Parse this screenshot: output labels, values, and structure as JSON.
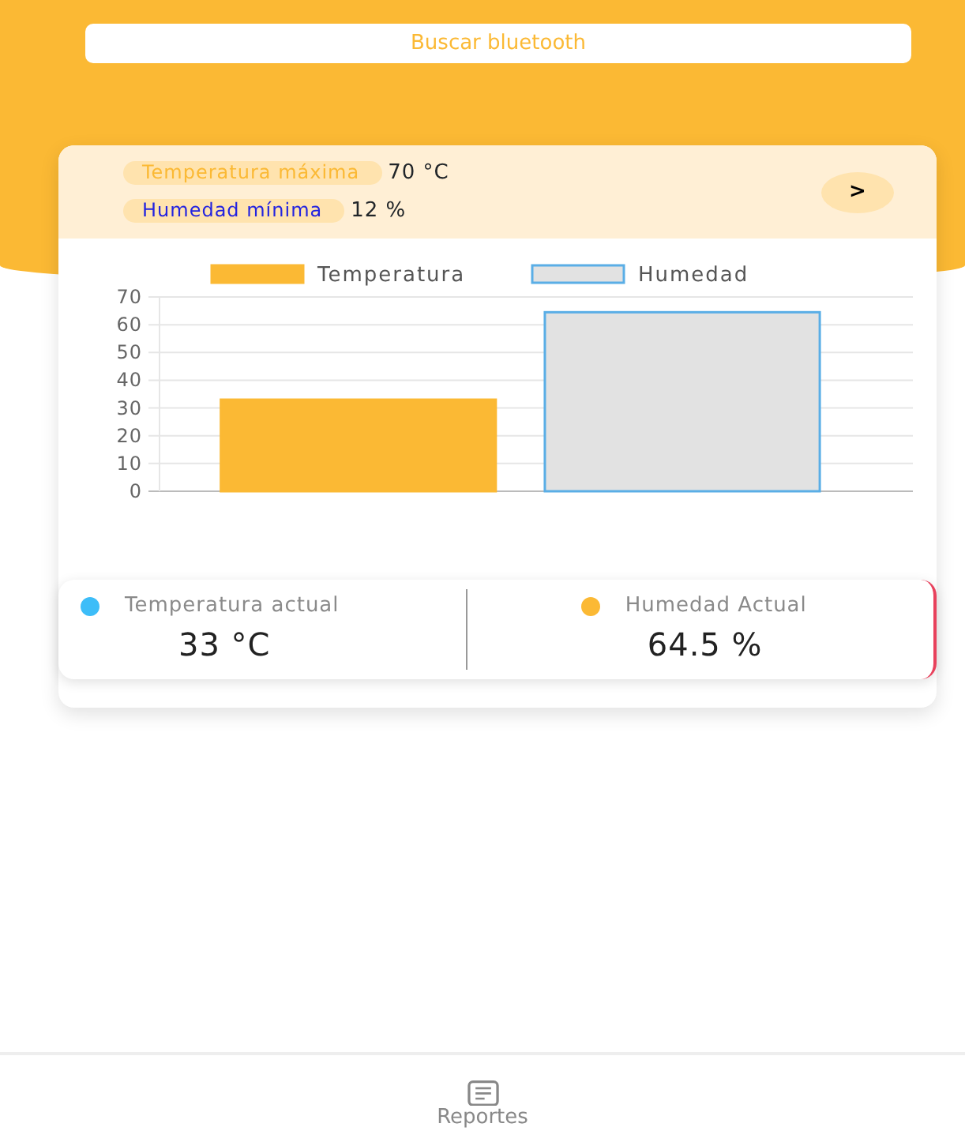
{
  "search_button": {
    "label": "Buscar bluetooth"
  },
  "limits": [
    {
      "label": "Temperatura máxima",
      "value": "70 °C",
      "color": "#fbb934"
    },
    {
      "label": "Humedad mínima",
      "value": "12 %",
      "color": "#2323e0"
    }
  ],
  "next_button": {
    "label": ">"
  },
  "chart_data": {
    "type": "bar",
    "grid": true,
    "legend": true,
    "ylim": [
      0,
      70
    ],
    "yticks": [
      0,
      10,
      20,
      30,
      40,
      50,
      60,
      70
    ],
    "series": [
      {
        "name": "Temperatura",
        "color": "#fbb934",
        "values": [
          33
        ]
      },
      {
        "name": "Humedad",
        "color": "#e2e2e2",
        "values": [
          64.5
        ]
      }
    ]
  },
  "readings": [
    {
      "label": "Temperatura actual",
      "value": "33 °C",
      "color": "#3dbdf8"
    },
    {
      "label": "Humedad Actual",
      "value": "64.5 %",
      "color": "#fbb934"
    }
  ],
  "bottom_nav": [
    {
      "label": "Reportes",
      "selected": false
    }
  ]
}
